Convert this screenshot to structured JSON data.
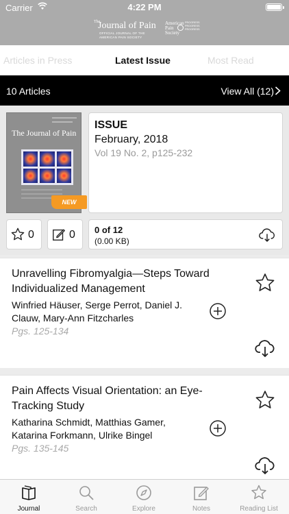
{
  "status_bar": {
    "carrier": "Carrier",
    "time": "4:22 PM"
  },
  "brand": {
    "the": "The",
    "journal_name": "Journal of Pain",
    "subtitle": "OFFICIAL JOURNAL OF THE AMERICAN PAIN SOCIETY",
    "society": "American Pain Society",
    "side_text": "PROGRESS PROGRESS PROGRESS"
  },
  "tabs": [
    {
      "label": "Articles in Press",
      "active": false
    },
    {
      "label": "Latest Issue",
      "active": true
    },
    {
      "label": "Most Read",
      "active": false
    }
  ],
  "count_bar": {
    "count": "10 Articles",
    "view_all": "View All (12)"
  },
  "issue": {
    "cover_title": "The Journal of Pain",
    "badge": "NEW",
    "label": "ISSUE",
    "date": "February, 2018",
    "volume": "Vol 19 No. 2, p125-232",
    "favorites_count": "0",
    "notes_count": "0",
    "downloaded": "0 of 12",
    "size": "(0.00 KB)"
  },
  "articles": [
    {
      "title": "Unravelling Fibromyalgia—Steps Toward Individualized Management",
      "authors": "Winfried Häuser, Serge Perrot, Daniel J. Clauw, Mary-Ann Fitzcharles",
      "pages": "Pgs. 125-134"
    },
    {
      "title": "Pain Affects Visual Orientation: an Eye-Tracking Study",
      "authors": "Katharina Schmidt, Matthias Gamer, Katarina Forkmann, Ulrike Bingel",
      "pages": "Pgs. 135-145"
    }
  ],
  "tab_bar": [
    {
      "label": "Journal",
      "icon": "journal-icon",
      "active": true
    },
    {
      "label": "Search",
      "icon": "search-icon",
      "active": false
    },
    {
      "label": "Explore",
      "icon": "compass-icon",
      "active": false
    },
    {
      "label": "Notes",
      "icon": "notes-icon",
      "active": false
    },
    {
      "label": "Reading List",
      "icon": "star-icon",
      "active": false
    }
  ],
  "colors": {
    "header_gray": "#ababab",
    "badge_orange": "#f59a23",
    "black_bar": "#000000"
  }
}
